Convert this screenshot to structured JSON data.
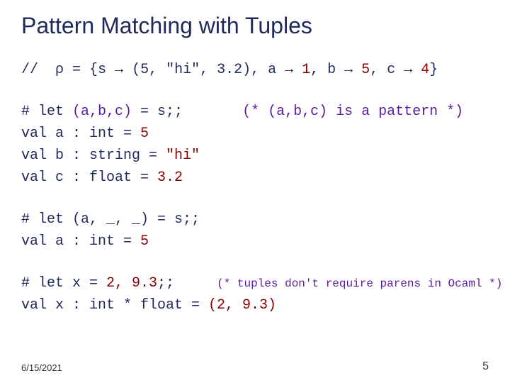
{
  "title": "Pattern Matching with Tuples",
  "env": {
    "prefix": "//  ",
    "rho": "ρ",
    "eq": " = {s ",
    "arr": "→",
    "tuple": " (5, \"hi\", 3.2), a ",
    "one": " 1",
    "b_to": ", b ",
    "five": " 5",
    "c_to": ", c ",
    "four": " 4",
    "close": "}"
  },
  "block1": {
    "l1a": "# let ",
    "l1b": "(a,b,c)",
    "l1c": " = s;;",
    "l1pad": "       ",
    "l1d": "(* (a,b,c) is a pattern *)",
    "l2a": "val a : int = ",
    "l2b": "5",
    "l3a": "val b : string = ",
    "l3b": "\"hi\"",
    "l4a": "val c : float = ",
    "l4b": "3.2"
  },
  "block2": {
    "l1": "# let (a, _, _) = s;;",
    "l2a": "val a : int = ",
    "l2b": "5"
  },
  "block3": {
    "l1a": "# let x = ",
    "l1b": "2, 9.3",
    "l1c": ";;",
    "l1pad": "     ",
    "l1d": "(* tuples don't require parens in Ocaml *)",
    "l2a": "val x : int * float = ",
    "l2b": "(2, 9.3)"
  },
  "footer": {
    "date": "6/15/2021",
    "page": "5"
  }
}
